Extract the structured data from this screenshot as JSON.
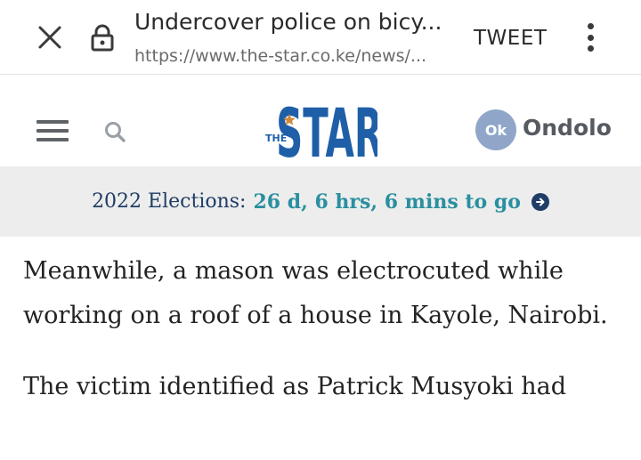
{
  "browser": {
    "page_title": "Undercover police on bicy...",
    "url": "https://www.the-star.co.ke/news/...",
    "action_label": "TWEET",
    "icons": {
      "close": "close-icon",
      "lock": "lock-icon",
      "more": "more-vert-icon"
    }
  },
  "site_header": {
    "logo_small": "THE",
    "logo_main": "STAR",
    "avatar_initials": "Ok",
    "username": "Ondolo",
    "brand_color": "#1f5fa8",
    "accent_color": "#d08a3c"
  },
  "banner": {
    "label": "2022 Elections:",
    "countdown": "26 d, 6 hrs, 6 mins to go",
    "label_color": "#1f3d66",
    "countdown_color": "#2a8fa0"
  },
  "article": {
    "paragraphs": [
      "Meanwhile, a mason was electrocuted while working on a roof of a house in Kayole, Nairobi.",
      "The victim identified as Patrick Musyoki had"
    ]
  }
}
